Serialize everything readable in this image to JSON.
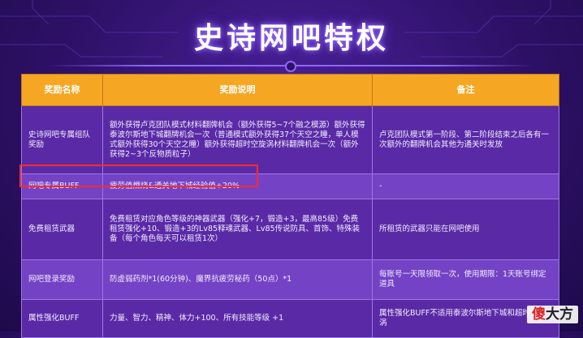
{
  "title": "史诗网吧特权",
  "table": {
    "headers": [
      "奖励名称",
      "奖励说明",
      "备注"
    ],
    "rows": [
      {
        "name": "史诗网吧专属组队奖励",
        "description": "额外获得卢克团队模式材料翻牌机会（额外获得5~7个融之模源）额外获得泰波尔斯地下城翻牌机会一次（普通模式额外获得37个天空之瞳，单人模式额外获得30个天空之瞳）额外获得超时空旋涡材料翻牌机会一次（额外获得2~3个反物质粒子）",
        "note": "卢克团队模式第一阶段、第二阶段结束之后各有一次额外的翻牌机会其他为通关时发放"
      },
      {
        "name": "网吧专属BUFF",
        "description": "疲劳值燃烧&通关地下城经验值+20%",
        "note": "-"
      },
      {
        "name": "免费租赁武器",
        "description": "免费租赁对应角色等级的神器武器（强化+7，锻造+3，最高85级）免费租赁强化+10、锻造+3的Lv85释魂武器、Lv85传说防具、首饰、特殊装备（每个角色每天可以租赁1次）",
        "note": "所租赁的武器只能在网吧使用"
      },
      {
        "name": "网吧登录奖励",
        "description": "防虚弱药剂*1(60分钟)、魔界抗疲劳秘药（50点）*1",
        "note": "每账号一天限领取一次，使用期限：1天账号绑定道具"
      },
      {
        "name": "属性强化BUFF",
        "description": "力量、智力、精神、体力+100、所有技能等级 +1",
        "note": "属性强化BUFF不适用泰波尔斯地下城和超时空旋涡"
      }
    ]
  },
  "watermark": {
    "part1": "傻",
    "part2": "大方"
  },
  "colors": {
    "background": "#2e1168",
    "header": "#f5a623",
    "row_dark": "#5a2aa6",
    "row_light": "#7442c4",
    "highlight": "#ff2b2b"
  }
}
